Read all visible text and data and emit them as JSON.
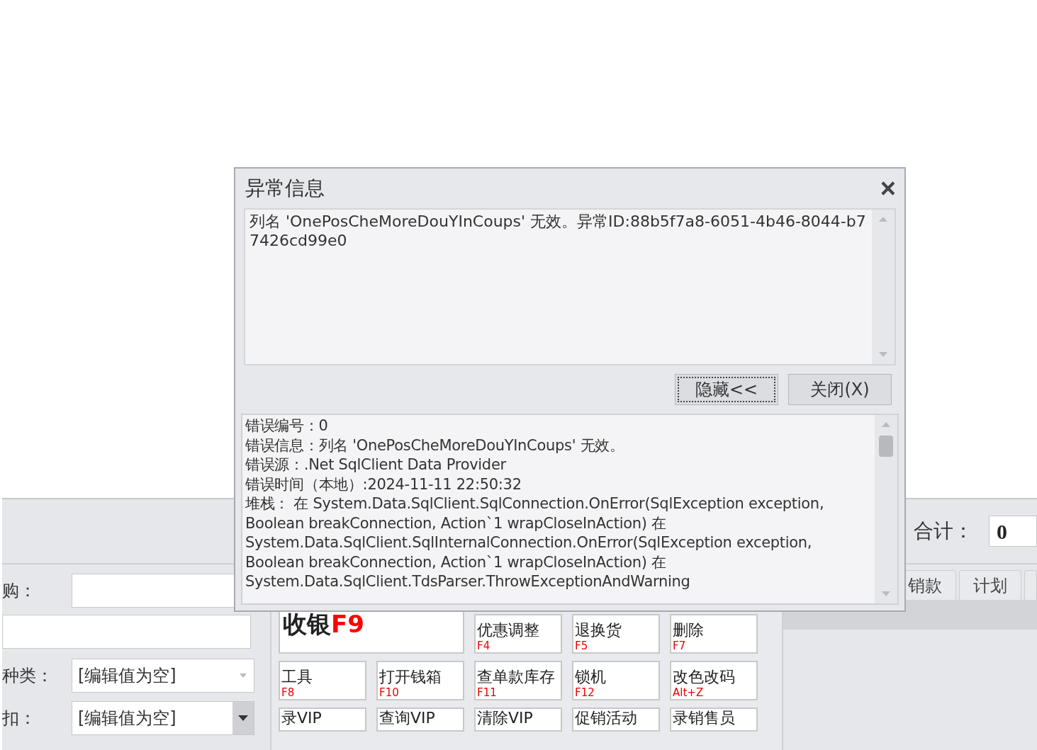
{
  "background_app": {
    "total": {
      "label": "合计：",
      "value": "0"
    },
    "form": [
      {
        "label": "购：",
        "kind": "text"
      },
      {
        "kind": "text"
      },
      {
        "label": "种类：",
        "kind": "combo",
        "value": "[编辑值为空]"
      },
      {
        "label": "扣：",
        "kind": "dropdown",
        "value": "[编辑值为空]"
      }
    ],
    "function_buttons": [
      {
        "label": "收银",
        "hotkey": "F9",
        "kind": "large"
      },
      {
        "label": "优惠调整",
        "hotkey": "F4",
        "kind": "normal"
      },
      {
        "label": "退换货",
        "hotkey": "F5",
        "kind": "normal"
      },
      {
        "label": "删除",
        "hotkey": "F7",
        "kind": "normal"
      },
      {
        "label": "工具",
        "hotkey": "F8",
        "kind": "normal"
      },
      {
        "label": "打开钱箱",
        "hotkey": "F10",
        "kind": "normal"
      },
      {
        "label": "查单款库存",
        "hotkey": "F11",
        "kind": "normal"
      },
      {
        "label": "锁机",
        "hotkey": "F12",
        "kind": "normal"
      },
      {
        "label": "改色改码",
        "hotkey": "Alt+Z",
        "kind": "normal"
      },
      {
        "label": "录VIP",
        "kind": "normal"
      },
      {
        "label": "查询VIP",
        "kind": "normal"
      },
      {
        "label": "清除VIP",
        "kind": "normal"
      },
      {
        "label": "促销活动",
        "kind": "normal"
      },
      {
        "label": "录销售员",
        "kind": "normal"
      }
    ],
    "tabs": [
      {
        "label": "销款",
        "selected": false
      },
      {
        "label": "计划",
        "selected": false
      },
      {
        "selected": false
      }
    ]
  },
  "dialog": {
    "title": "异常信息",
    "close": "×",
    "message": "列名 'OnePosCheMoreDouYInCoups' 无效。异常ID:88b5f7a8-6051-4b46-8044-b77426cd99e0",
    "buttons": [
      {
        "label": "隐藏<<",
        "focused": true
      },
      {
        "label": "关闭(X)",
        "focused": false
      }
    ],
    "details": [
      "错误编号：0",
      "错误信息：列名 'OnePosCheMoreDouYInCoups' 无效。",
      "错误源：.Net SqlClient Data Provider",
      "错误时间（本地）:2024-11-11 22:50:32",
      "堆栈：    在 System.Data.SqlClient.SqlConnection.OnError(SqlException exception,",
      "Boolean breakConnection, Action`1 wrapCloseInAction)   在",
      "System.Data.SqlClient.SqlInternalConnection.OnError(SqlException exception,",
      "Boolean breakConnection, Action`1 wrapCloseInAction)   在",
      "System.Data.SqlClient.TdsParser.ThrowExceptionAndWarning"
    ]
  }
}
